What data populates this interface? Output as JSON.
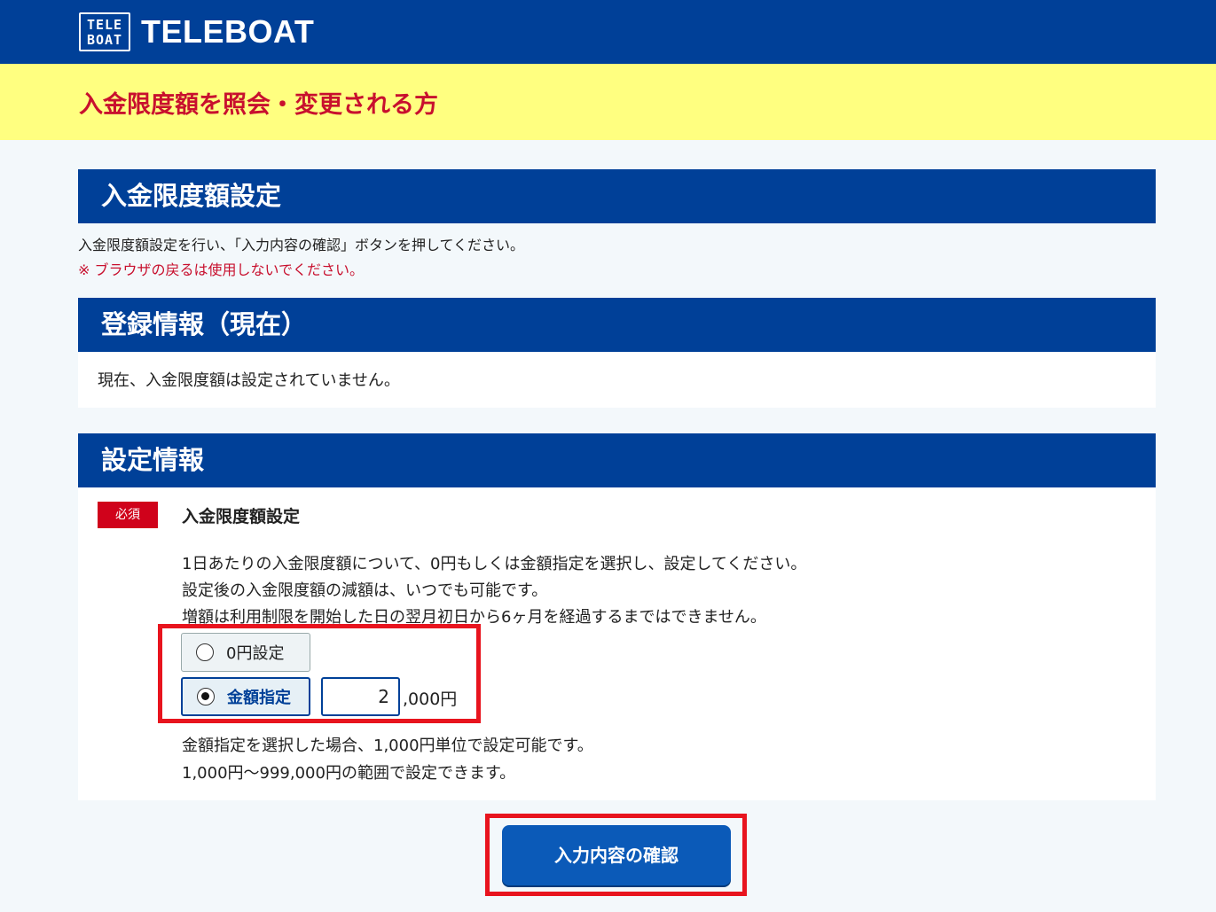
{
  "header": {
    "logo_box": "TELE BOAT",
    "logo_text": "TELEBOAT"
  },
  "page_title": "入金限度額を照会・変更される方",
  "section_limit": {
    "heading": "入金限度額設定",
    "instruction": "入金限度額設定を行い、「入力内容の確認」ボタンを押してください。",
    "warning": "※ ブラウザの戻るは使用しないでください。"
  },
  "section_current": {
    "heading": "登録情報（現在）",
    "text": "現在、入金限度額は設定されていません。"
  },
  "section_settings": {
    "heading": "設定情報",
    "required_badge": "必須",
    "field_label": "入金限度額設定",
    "desc_lines": [
      "1日あたりの入金限度額について、0円もしくは金額指定を選択し、設定してください。",
      "設定後の入金限度額の減額は、いつでも可能です。",
      "増額は利用制限を開始した日の翌月初日から6ヶ月を経過するまではできません。"
    ],
    "option_zero": "0円設定",
    "option_amount": "金額指定",
    "selected_option": "金額指定",
    "amount_value": "2",
    "amount_suffix": ",000円",
    "note_lines": [
      "金額指定を選択した場合、1,000円単位で設定可能です。",
      "1,000円～999,000円の範囲で設定できます。"
    ]
  },
  "confirm_button": "入力内容の確認",
  "colors": {
    "brand": "#004098",
    "accent_red": "#c8102e",
    "title_band": "#ffff80",
    "highlight": "#e8141e"
  }
}
